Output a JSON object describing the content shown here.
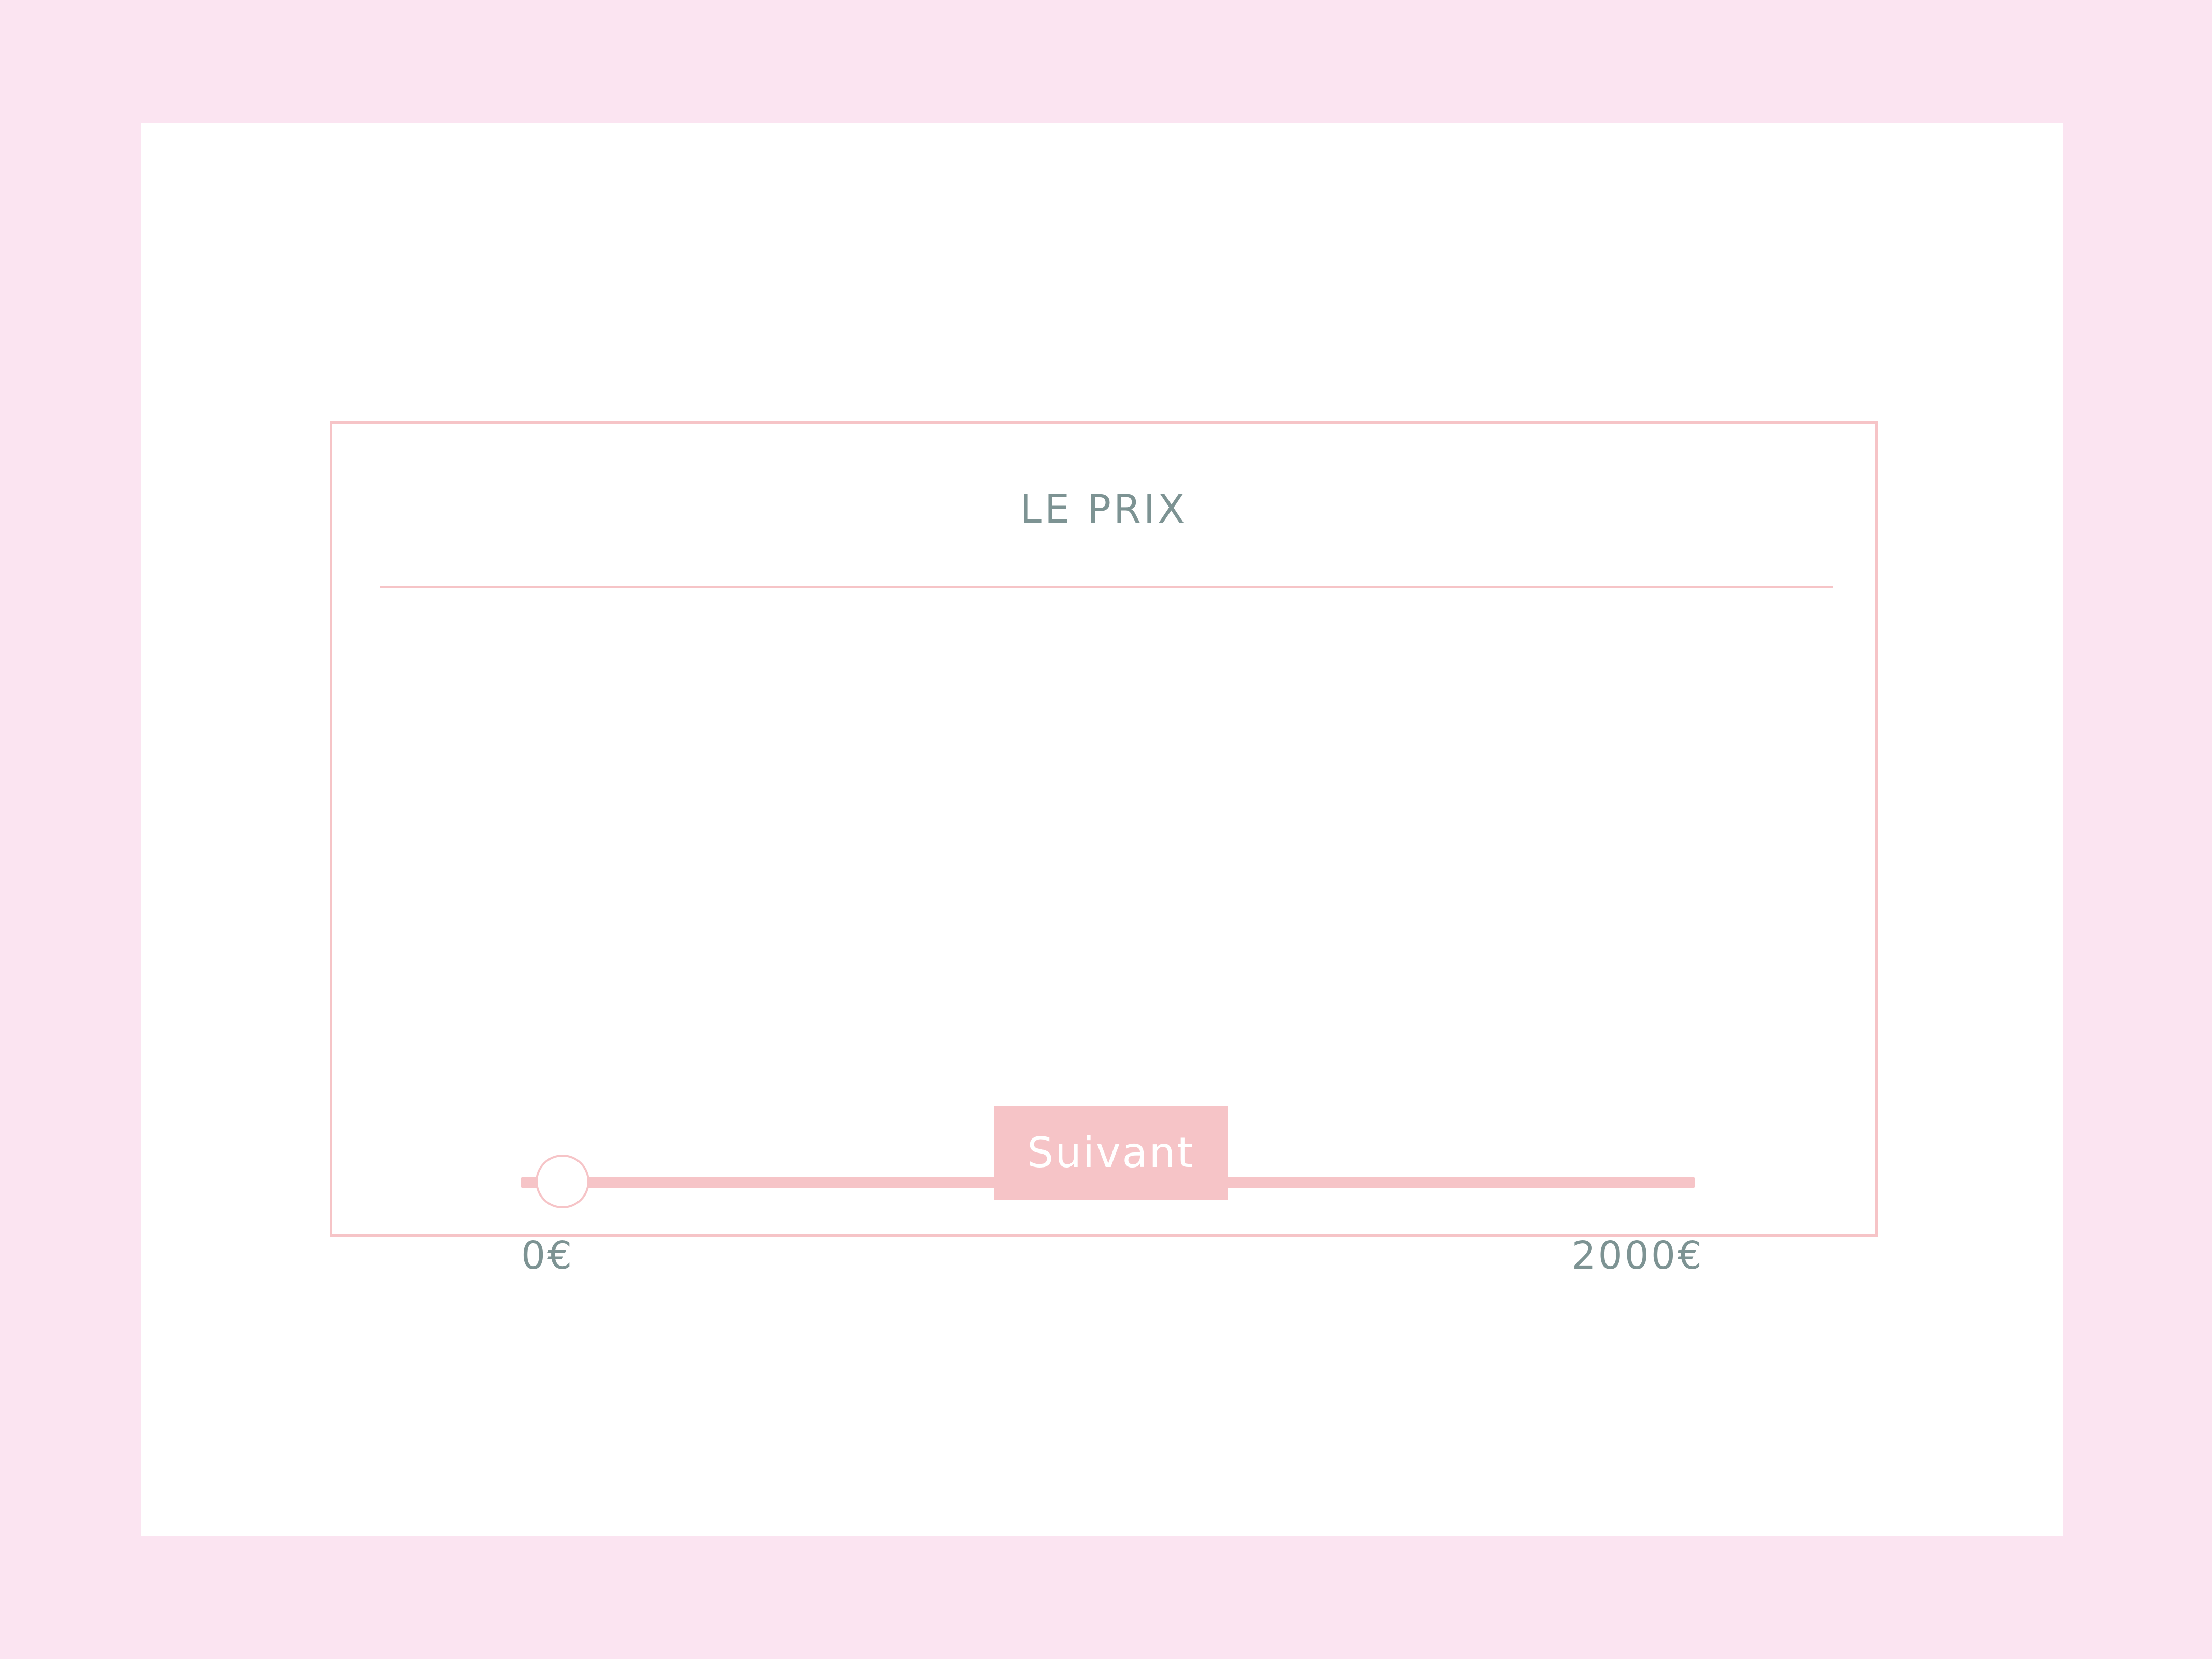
{
  "card": {
    "title": "LE PRIX"
  },
  "price_slider": {
    "min_label": "0€",
    "max_label": "2000€",
    "min": 0,
    "max": 2000,
    "value": 0
  },
  "next_button": {
    "label": "Suivant"
  },
  "colors": {
    "background": "#fbe4f1",
    "panel": "#ffffff",
    "accent_pink": "#f6c4c7",
    "text_grey": "#7d9393"
  }
}
